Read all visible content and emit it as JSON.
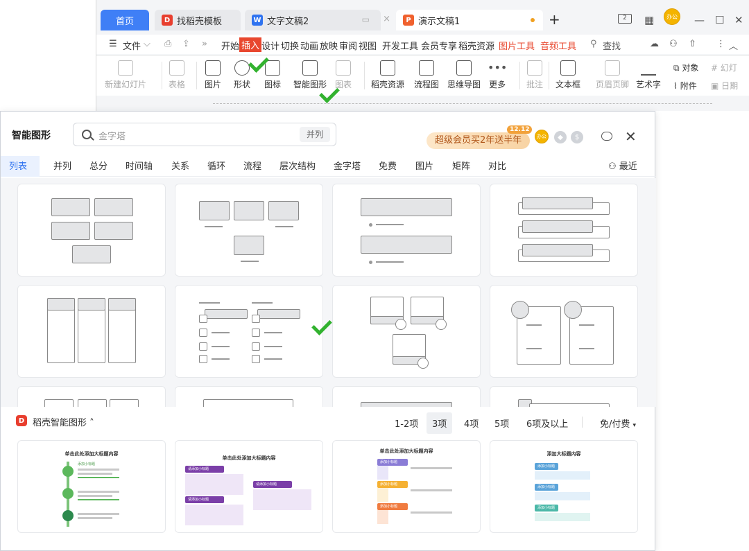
{
  "tabs": [
    {
      "label": "首页"
    },
    {
      "label": "找稻壳模板"
    },
    {
      "label": "文字文稿2"
    },
    {
      "label": "演示文稿1"
    }
  ],
  "window": {
    "avatar": "办公"
  },
  "menu": {
    "file": "文件",
    "items": [
      "开始",
      "插入",
      "设计",
      "切换",
      "动画",
      "放映",
      "审阅",
      "视图",
      "开发工具",
      "会员专享",
      "稻壳资源"
    ],
    "picture_tools": "图片工具",
    "audio_tools": "音频工具",
    "search": "查找"
  },
  "toolbar": {
    "new_slide": "新建幻灯片",
    "table": "表格",
    "picture": "图片",
    "shape": "形状",
    "icon": "图标",
    "smart_graphic": "智能图形",
    "chart": "图表",
    "docer_resources": "稻壳资源",
    "flowchart": "流程图",
    "mindmap": "思维导图",
    "more": "更多",
    "annotate": "批注",
    "textbox": "文本框",
    "header_footer": "页眉页脚",
    "wordart": "艺术字",
    "object": "对象",
    "attachment": "附件",
    "slide_num": "幻灯",
    "date": "日期"
  },
  "dialog": {
    "title": "智能图形",
    "search_placeholder": "金字塔",
    "search_chip": "并列",
    "promo_text": "超级会员买2年送半年",
    "promo_badge": "12.12",
    "avatar": "办公",
    "categories": [
      "列表",
      "并列",
      "总分",
      "时间轴",
      "关系",
      "循环",
      "流程",
      "层次结构",
      "金字塔",
      "免费",
      "图片",
      "矩阵",
      "对比"
    ],
    "recent": "最近",
    "docer_title": "稻壳智能图形",
    "filters": [
      "1-2项",
      "3项",
      "4项",
      "5项",
      "6项及以上"
    ],
    "price_filter": "免/付费",
    "templates": [
      {
        "title": "单击此处添加大标题内容",
        "item": "添加小标题"
      },
      {
        "title": "单击此处添加大标题内容",
        "item": "请添加小标题"
      },
      {
        "title": "单击此处添加大标题内容",
        "item": "添加小标题"
      },
      {
        "title": "添加大标题内容",
        "item": "添加小标题"
      }
    ]
  },
  "colors": {
    "accent": "#2f73f0",
    "home_tab": "#3f7ff6",
    "menu_active": "#e8472e",
    "check": "#32b22f"
  }
}
